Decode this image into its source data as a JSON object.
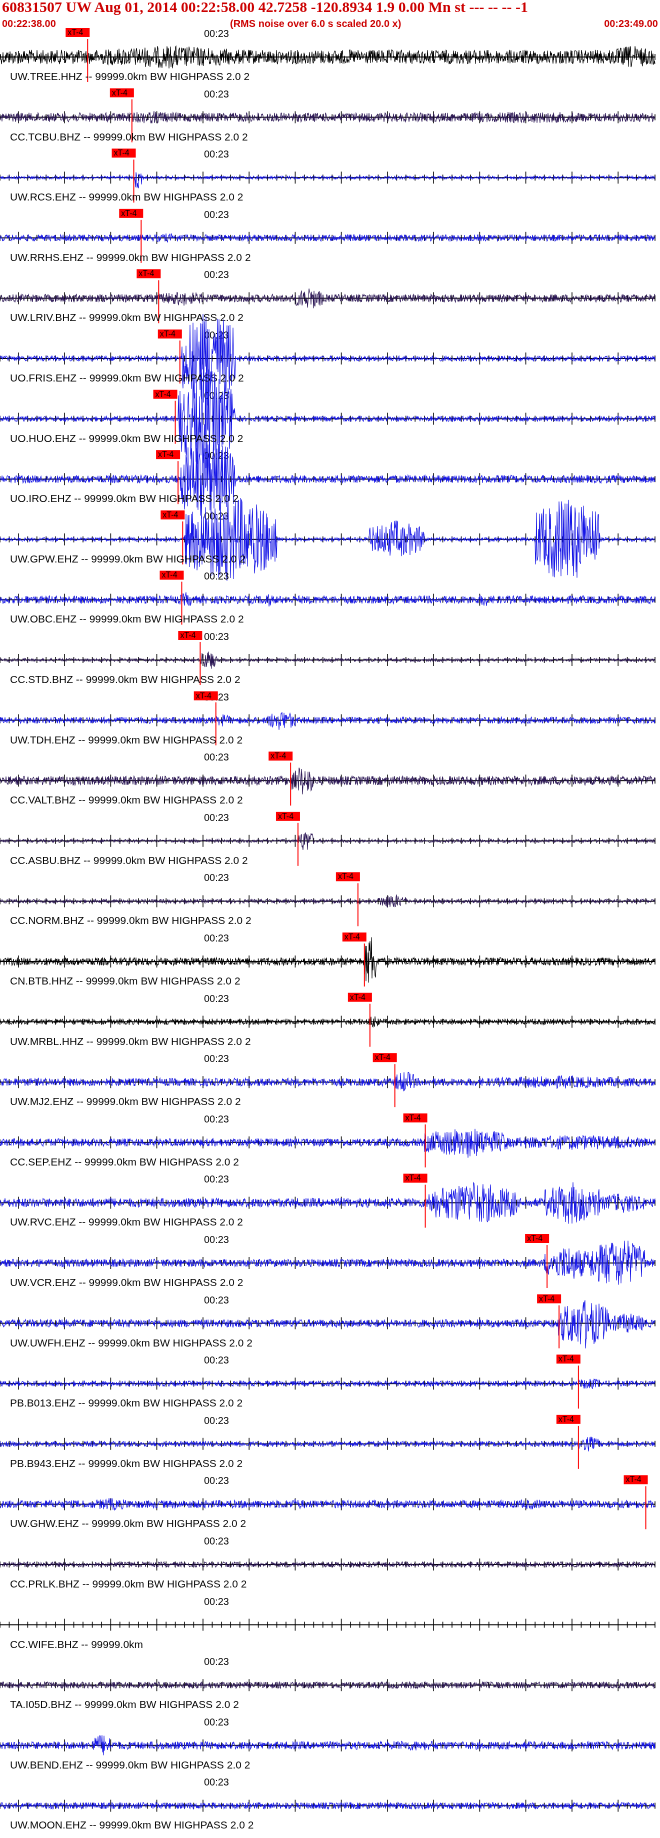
{
  "header": {
    "title": "60831507 UW Aug 01, 2014 00:22:58.00   42.7258 -120.8934  1.9 0.00 Mn st --- -- --   -1",
    "start_time": "00:22:38.00",
    "note": "(RMS noise over 6.0 s scaled 20.0 x)",
    "end_time": "00:23:49.00"
  },
  "colors": {
    "header": "#cc0000",
    "pick": "#ff0000",
    "axis": "#000000",
    "blue": "#1515e6",
    "purple": "#2b1655",
    "black": "#000000"
  },
  "chart_data": {
    "type": "line",
    "x_unit": "time",
    "xlim": [
      "00:22:38.00",
      "00:23:49.00"
    ],
    "tick_label": "00:23",
    "pick_label": "xT-4",
    "filter": "HIGHPASS  2.0  2",
    "traces": [
      {
        "label": "UW.TREE.HHZ -- 99999.0km BW  HIGHPASS  2.0  2",
        "color": "black",
        "pick_s": 9.5,
        "pick_text": true,
        "amp": 0.65,
        "bursts": [
          [
            10,
            27,
            0.9
          ],
          [
            66,
            71,
            0.9
          ]
        ],
        "noise": 0.55
      },
      {
        "label": "CC.TCBU.BHZ -- 99999.0km BW  HIGHPASS  2.0  2",
        "color": "purple",
        "pick_s": 14.3,
        "pick_text": true,
        "amp": 0.55,
        "bursts": [
          [
            13,
            20,
            0.5
          ],
          [
            45,
            70,
            0.45
          ]
        ],
        "noise": 0.35
      },
      {
        "label": "UW.RCS.EHZ -- 99999.0km BW  HIGHPASS  2.0  2",
        "color": "blue",
        "pick_s": 14.5,
        "pick_text": true,
        "amp": 0.35,
        "bursts": [
          [
            14.5,
            15.5,
            1.0
          ]
        ],
        "noise": 0.12
      },
      {
        "label": "UW.RRHS.EHZ -- 99999.0km BW  HIGHPASS  2.0  2",
        "color": "blue",
        "pick_s": 15.3,
        "pick_text": true,
        "amp": 0.35,
        "bursts": [
          [
            15.3,
            21,
            0.35
          ],
          [
            36,
            40,
            0.3
          ]
        ],
        "noise": 0.25
      },
      {
        "label": "UW.LRIV.BHZ -- 99999.0km BW  HIGHPASS  2.0  2",
        "color": "purple",
        "pick_s": 17.2,
        "pick_text": true,
        "amp": 0.5,
        "bursts": [
          [
            17.5,
            22,
            0.6
          ],
          [
            32,
            35,
            0.9
          ]
        ],
        "noise": 0.3
      },
      {
        "label": "UO.FRIS.EHZ -- 99999.0km BW  HIGHPASS  2.0  2",
        "color": "blue",
        "pick_s": 19.5,
        "pick_text": true,
        "amp": 0.25,
        "bursts": [
          [
            19.7,
            25.5,
            4.0
          ]
        ],
        "noise": 0.2
      },
      {
        "label": "UO.HUO.EHZ -- 99999.0km BW  HIGHPASS  2.0  2",
        "color": "blue",
        "pick_s": 19.0,
        "pick_text": true,
        "amp": 0.25,
        "bursts": [
          [
            19.3,
            25.5,
            4.0
          ]
        ],
        "noise": 0.2
      },
      {
        "label": "UO.IRO.EHZ -- 99999.0km BW  HIGHPASS  2.0  2",
        "color": "blue",
        "pick_s": 19.3,
        "pick_text": true,
        "amp": 0.35,
        "bursts": [
          [
            19.5,
            25.5,
            3.5
          ]
        ],
        "noise": 0.3
      },
      {
        "label": "UW.GPW.EHZ -- 99999.0km BW  HIGHPASS  2.0  2",
        "color": "blue",
        "pick_s": 19.8,
        "pick_text": true,
        "amp": 0.2,
        "bursts": [
          [
            20,
            30,
            3.5
          ],
          [
            40,
            46,
            1.5
          ],
          [
            58,
            65,
            3.5
          ]
        ],
        "noise": 0.15
      },
      {
        "label": "UW.OBC.EHZ -- 99999.0km BW  HIGHPASS  2.0  2",
        "color": "blue",
        "pick_s": 19.7,
        "pick_text": true,
        "amp": 0.4,
        "bursts": [
          [
            19.5,
            21,
            0.6
          ],
          [
            28.5,
            29.5,
            0.6
          ],
          [
            52,
            53,
            0.6
          ]
        ],
        "noise": 0.3
      },
      {
        "label": "CC.STD.BHZ -- 99999.0km BW  HIGHPASS  2.0  2",
        "color": "purple",
        "pick_s": 21.7,
        "pick_text": true,
        "amp": 0.2,
        "bursts": [
          [
            21.7,
            23.5,
            0.8
          ]
        ],
        "noise": 0.12
      },
      {
        "label": "UW.TDH.EHZ -- 99999.0km BW  HIGHPASS  2.0  2",
        "color": "blue",
        "pick_s": 23.4,
        "pick_text": true,
        "amp": 0.3,
        "bursts": [
          [
            23.4,
            25,
            0.5
          ],
          [
            29,
            32,
            0.8
          ]
        ],
        "noise": 0.25
      },
      {
        "label": "CC.VALT.BHZ -- 99999.0km BW  HIGHPASS  2.0  2",
        "color": "purple",
        "pick_s": 31.5,
        "pick_text": true,
        "amp": 0.5,
        "bursts": [
          [
            25,
            30,
            0.4
          ],
          [
            31.5,
            34,
            1.2
          ]
        ],
        "noise": 0.35
      },
      {
        "label": "CC.ASBU.BHZ -- 99999.0km BW  HIGHPASS  2.0  2",
        "color": "purple",
        "pick_s": 32.3,
        "pick_text": true,
        "amp": 0.35,
        "bursts": [
          [
            32.3,
            34,
            0.9
          ]
        ],
        "noise": 0.12
      },
      {
        "label": "CC.NORM.BHZ -- 99999.0km BW  HIGHPASS  2.0  2",
        "color": "purple",
        "pick_s": 38.8,
        "pick_text": true,
        "amp": 0.3,
        "bursts": [
          [
            41,
            44,
            0.6
          ]
        ],
        "noise": 0.15
      },
      {
        "label": "CN.BTB.HHZ -- 99999.0km BW  HIGHPASS  2.0  2",
        "color": "black",
        "pick_s": 39.5,
        "pick_text": true,
        "amp": 0.4,
        "bursts": [
          [
            39.5,
            40.8,
            2.2
          ]
        ],
        "noise": 0.3
      },
      {
        "label": "UW.MRBL.HHZ -- 99999.0km BW  HIGHPASS  2.0  2",
        "color": "black",
        "pick_s": 40.1,
        "pick_text": true,
        "amp": 0.25,
        "bursts": [
          [
            40.1,
            41,
            0.6
          ]
        ],
        "noise": 0.2
      },
      {
        "label": "UW.MJ2.EHZ -- 99999.0km BW  HIGHPASS  2.0  2",
        "color": "blue",
        "pick_s": 42.8,
        "pick_text": true,
        "amp": 0.35,
        "bursts": [
          [
            42.8,
            45,
            0.9
          ],
          [
            52,
            70,
            0.5
          ]
        ],
        "noise": 0.3
      },
      {
        "label": "CC.SEP.EHZ -- 99999.0km BW  HIGHPASS  2.0  2",
        "color": "blue",
        "pick_s": 46.1,
        "pick_text": true,
        "amp": 0.4,
        "bursts": [
          [
            46,
            55,
            1.2
          ],
          [
            55,
            70,
            0.6
          ]
        ],
        "noise": 0.3
      },
      {
        "label": "UW.RVC.EHZ -- 99999.0km BW  HIGHPASS  2.0  2",
        "color": "blue",
        "pick_s": 46.1,
        "pick_text": true,
        "amp": 0.4,
        "bursts": [
          [
            46.5,
            56,
            1.7
          ],
          [
            59,
            65,
            1.7
          ],
          [
            65,
            70,
            0.8
          ]
        ],
        "noise": 0.35
      },
      {
        "label": "UW.VCR.EHZ -- 99999.0km BW  HIGHPASS  2.0  2",
        "color": "blue",
        "pick_s": 59.3,
        "pick_text": true,
        "amp": 0.4,
        "bursts": [
          [
            59,
            64,
            1.4
          ],
          [
            64,
            70,
            2.0
          ]
        ],
        "noise": 0.3
      },
      {
        "label": "UW.UWFH.EHZ -- 99999.0km BW  HIGHPASS  2.0  2",
        "color": "blue",
        "pick_s": 60.6,
        "pick_text": true,
        "amp": 0.4,
        "bursts": [
          [
            60.5,
            66,
            2.0
          ],
          [
            66,
            70,
            0.8
          ]
        ],
        "noise": 0.3
      },
      {
        "label": "PB.B013.EHZ -- 99999.0km BW  HIGHPASS  2.0  2",
        "color": "blue",
        "pick_s": 62.7,
        "pick_text": true,
        "amp": 0.3,
        "bursts": [
          [
            62.7,
            65,
            0.5
          ]
        ],
        "noise": 0.2
      },
      {
        "label": "PB.B943.EHZ -- 99999.0km BW  HIGHPASS  2.0  2",
        "color": "blue",
        "pick_s": 62.7,
        "pick_text": true,
        "amp": 0.3,
        "bursts": [
          [
            62.7,
            65,
            0.6
          ]
        ],
        "noise": 0.2
      },
      {
        "label": "UW.GHW.EHZ -- 99999.0km BW  HIGHPASS  2.0  2",
        "color": "blue",
        "pick_s": 70.0,
        "pick_text": true,
        "amp": 0.35,
        "bursts": [
          [
            10,
            14,
            0.5
          ],
          [
            30,
            34,
            0.4
          ],
          [
            55,
            60,
            0.4
          ]
        ],
        "noise": 0.3
      },
      {
        "label": "CC.PRLK.BHZ -- 99999.0km BW  HIGHPASS  2.0  2",
        "color": "purple",
        "pick_s": null,
        "pick_text": false,
        "amp": 0.25,
        "bursts": [],
        "noise": 0.2
      },
      {
        "label": "CC.WIFE.BHZ -- 99999.0km",
        "color": "purple",
        "pick_s": null,
        "pick_text": false,
        "amp": 0.0,
        "bursts": [],
        "noise": 0.0
      },
      {
        "label": "TA.I05D.BHZ -- 99999.0km BW  HIGHPASS  2.0  2",
        "color": "purple",
        "pick_s": null,
        "pick_text": false,
        "amp": 0.3,
        "bursts": [],
        "noise": 0.25
      },
      {
        "label": "UW.BEND.EHZ -- 99999.0km BW  HIGHPASS  2.0  2",
        "color": "blue",
        "pick_s": null,
        "pick_text": false,
        "amp": 0.35,
        "bursts": [
          [
            10,
            12,
            0.9
          ],
          [
            40,
            50,
            0.4
          ]
        ],
        "noise": 0.3
      },
      {
        "label": "UW.MOON.EHZ -- 99999.0km BW  HIGHPASS  2.0  2",
        "color": "blue",
        "pick_s": null,
        "pick_text": false,
        "amp": 0.3,
        "bursts": [],
        "noise": 0.25
      }
    ]
  }
}
